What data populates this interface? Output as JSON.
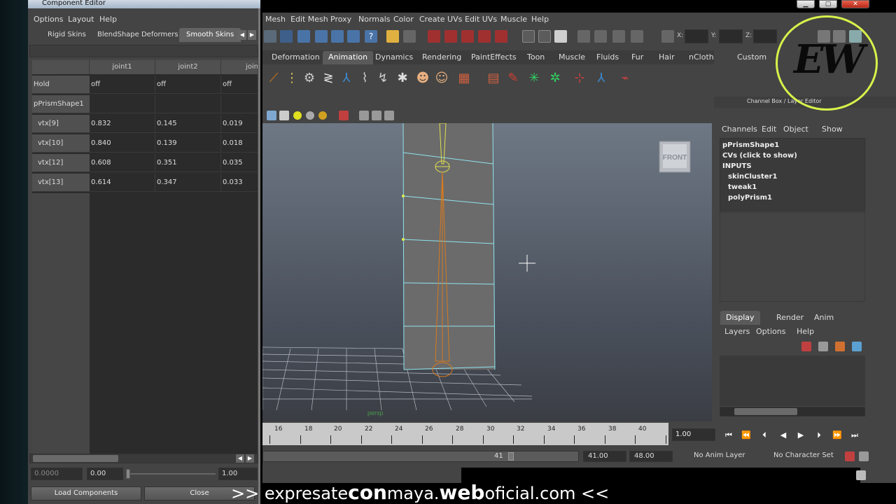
{
  "component_editor": {
    "title": "Component Editor",
    "menus": [
      "Options",
      "Layout",
      "Help"
    ],
    "tabs": [
      "Rigid Skins",
      "BlendShape Deformers",
      "Smooth Skins"
    ],
    "active_tab": "Smooth Skins",
    "columns": [
      "joint1",
      "joint2",
      "join"
    ],
    "hold_row": {
      "label": "Hold",
      "values": [
        "off",
        "off",
        "off"
      ]
    },
    "shape_row": {
      "label": "pPrismShape1"
    },
    "rows": [
      {
        "label": "vtx[9]",
        "values": [
          "0.832",
          "0.145",
          "0.019"
        ]
      },
      {
        "label": "vtx[10]",
        "values": [
          "0.840",
          "0.139",
          "0.018"
        ]
      },
      {
        "label": "vtx[12]",
        "values": [
          "0.608",
          "0.351",
          "0.035"
        ]
      },
      {
        "label": "vtx[13]",
        "values": [
          "0.614",
          "0.347",
          "0.033"
        ]
      }
    ],
    "slider_min": "0.0000",
    "slider_value": "0.00",
    "slider_max": "1.00",
    "load_button": "Load Components",
    "close_button": "Close"
  },
  "maya": {
    "menus": [
      "Mesh",
      "Edit Mesh",
      "Proxy",
      "Normals",
      "Color",
      "Create UVs",
      "Edit UVs",
      "Muscle",
      "Help"
    ],
    "coord_labels": {
      "x": "X:",
      "y": "Y:",
      "z": "Z:"
    },
    "shelf_tabs": [
      "Deformation",
      "Animation",
      "Dynamics",
      "Rendering",
      "PaintEffects",
      "Toon",
      "Muscle",
      "Fluids",
      "Fur",
      "Hair",
      "nCloth",
      "Custom"
    ],
    "active_shelf_tab": "Animation",
    "viewcube_label": "FRONT",
    "camera_label": "persp",
    "channel_box": {
      "header": "Channel Box / Layer Editor",
      "menus": [
        "Channels",
        "Edit",
        "Object",
        "Show"
      ],
      "object": "pPrismShape1",
      "cvs": "CVs (click to show)",
      "inputs_label": "INPUTS",
      "inputs": [
        "skinCluster1",
        "tweak1",
        "polyPrism1"
      ]
    },
    "layer_editor": {
      "tabs": [
        "Display",
        "Render",
        "Anim"
      ],
      "active_tab": "Display",
      "menus": [
        "Layers",
        "Options",
        "Help"
      ]
    },
    "timeline": {
      "ticks": [
        "16",
        "18",
        "20",
        "22",
        "24",
        "26",
        "28",
        "30",
        "32",
        "34",
        "36",
        "38",
        "40"
      ],
      "current_frame": "1.00"
    },
    "range": {
      "current": "41",
      "start": "41.00",
      "end": "48.00",
      "anim_layer": "No Anim Layer",
      "character_set": "No Character Set"
    }
  },
  "banner": {
    "prefix": ">>",
    "text_a": "expresate",
    "text_b": "con",
    "text_c": "maya.",
    "text_d": "web",
    "text_e": "oficial.com",
    "suffix": "<<"
  },
  "logo": {
    "text": "EW"
  },
  "colors": {
    "accent": "#d8f24a",
    "orange_joint": "#d97a1c",
    "cyan_wire": "#8fe3ee"
  }
}
